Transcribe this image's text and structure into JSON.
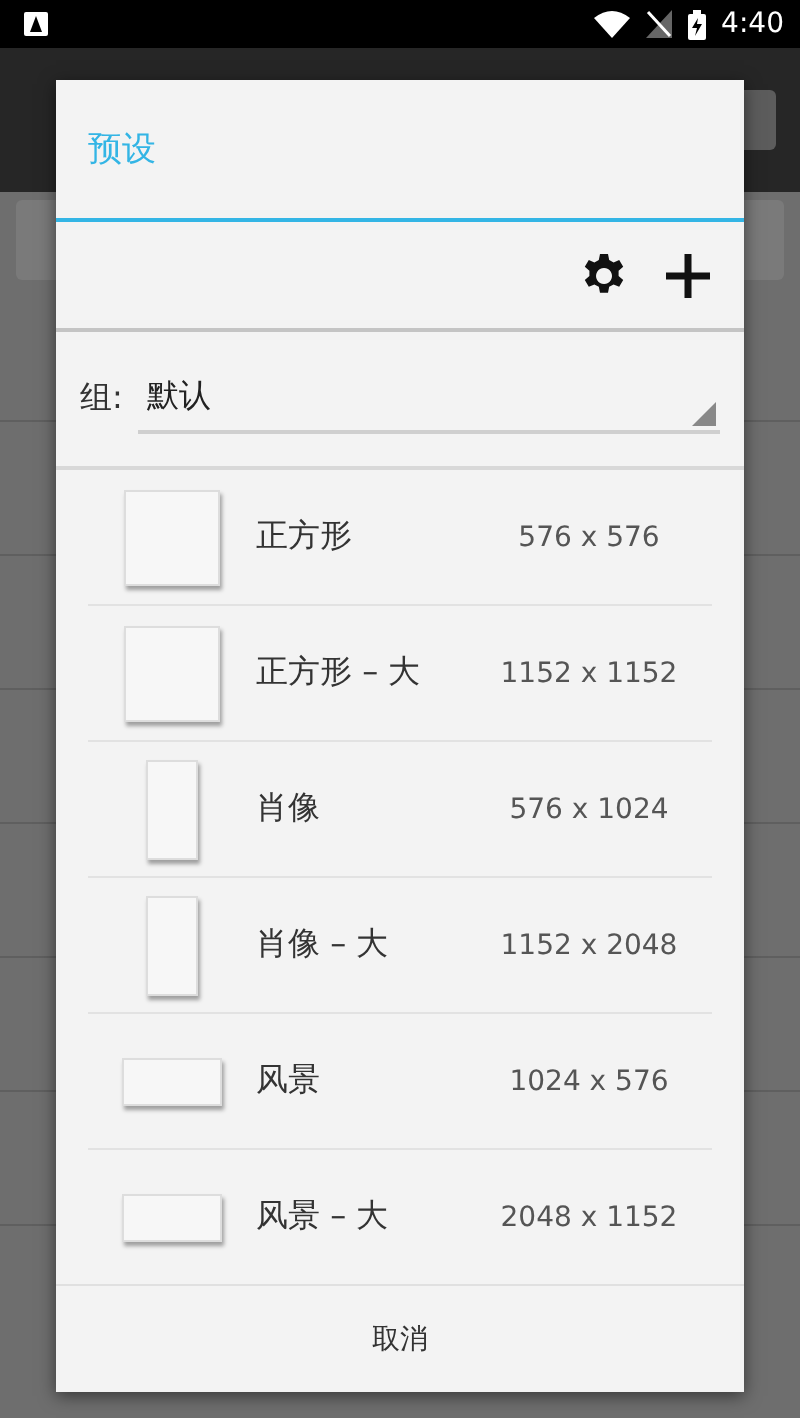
{
  "status_bar": {
    "time": "4:40"
  },
  "dialog": {
    "title": "预设",
    "group_label": "组:",
    "group_value": "默认",
    "presets": [
      {
        "name": "正方形",
        "size": "576 x 576",
        "kind": "square"
      },
      {
        "name": "正方形 – 大",
        "size": "1152 x 1152",
        "kind": "square"
      },
      {
        "name": "肖像",
        "size": "576 x 1024",
        "kind": "portrait"
      },
      {
        "name": "肖像 – 大",
        "size": "1152 x 2048",
        "kind": "portrait"
      },
      {
        "name": "风景",
        "size": "1024 x 576",
        "kind": "landscape"
      },
      {
        "name": "风景 – 大",
        "size": "2048 x 1152",
        "kind": "landscape"
      }
    ],
    "cancel": "取消"
  }
}
